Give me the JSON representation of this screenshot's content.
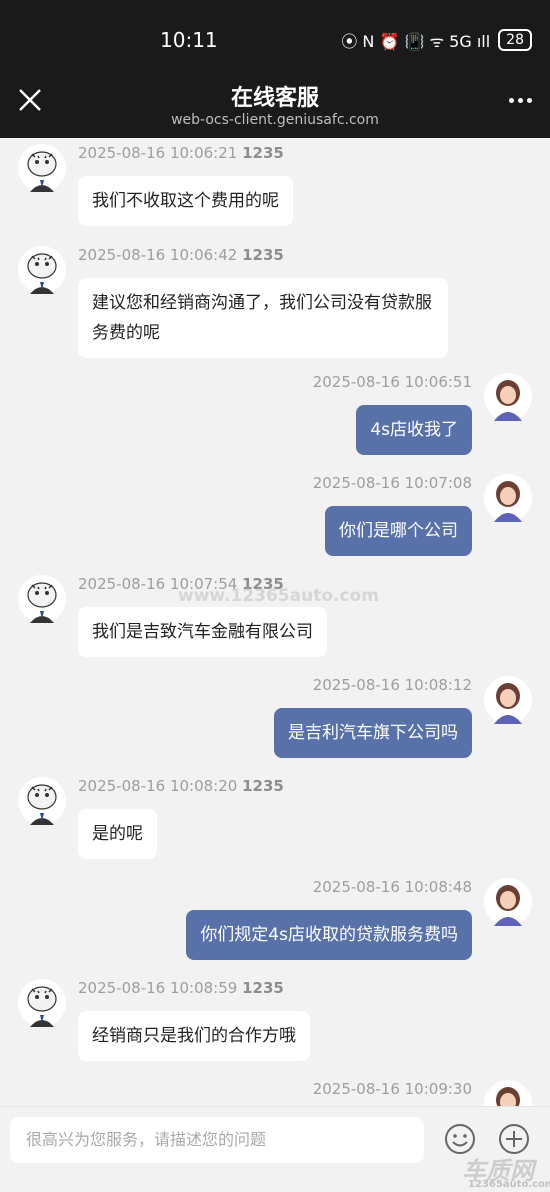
{
  "status": {
    "time": "10:11",
    "icons": "⦿ N ⏰ 📳 ᯤ 5G ıll",
    "battery": "28"
  },
  "header": {
    "title": "在线客服",
    "subtitle": "web-ocs-client.geniusafc.com"
  },
  "messages": [
    {
      "side": "agent",
      "time": "2025-08-16 10:06:21",
      "id": "1235",
      "text": "我们不收取这个费用的呢"
    },
    {
      "side": "agent",
      "time": "2025-08-16 10:06:42",
      "id": "1235",
      "text": "建议您和经销商沟通了，我们公司没有贷款服务费的呢"
    },
    {
      "side": "user",
      "time": "2025-08-16 10:06:51",
      "text": "4s店收我了"
    },
    {
      "side": "user",
      "time": "2025-08-16 10:07:08",
      "text": "你们是哪个公司"
    },
    {
      "side": "agent",
      "time": "2025-08-16 10:07:54",
      "id": "1235",
      "text": "我们是吉致汽车金融有限公司"
    },
    {
      "side": "user",
      "time": "2025-08-16 10:08:12",
      "text": "是吉利汽车旗下公司吗"
    },
    {
      "side": "agent",
      "time": "2025-08-16 10:08:20",
      "id": "1235",
      "text": "是的呢"
    },
    {
      "side": "user",
      "time": "2025-08-16 10:08:48",
      "text": "你们规定4s店收取的贷款服务费吗"
    },
    {
      "side": "agent",
      "time": "2025-08-16 10:08:59",
      "id": "1235",
      "text": "经销商只是我们的合作方哦"
    },
    {
      "side": "user",
      "time": "2025-08-16 10:09:30",
      "text": ""
    }
  ],
  "input": {
    "placeholder": "很高兴为您服务，请描述您的问题"
  },
  "icons": {
    "close": "close-icon",
    "more": "more-icon",
    "emoji": "emoji-icon",
    "plus": "plus-icon"
  },
  "watermark": {
    "center": "www.12365auto.com",
    "logo": "车质网",
    "logo_url": "12365auto.com"
  },
  "colors": {
    "user_bubble": "#5872a9",
    "agent_bubble": "#ffffff",
    "background": "#f2f2f2",
    "topbar": "#1a1a1a"
  }
}
